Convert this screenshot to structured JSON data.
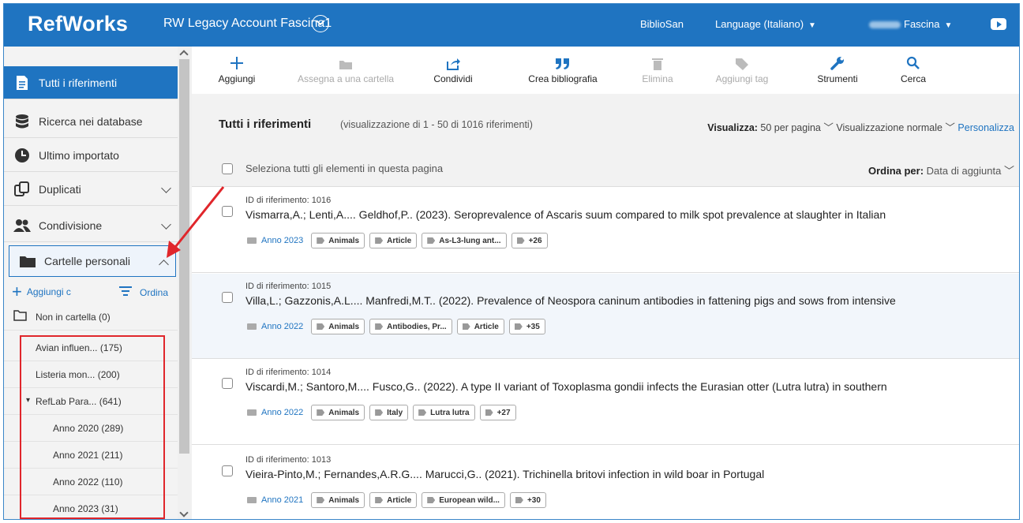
{
  "header": {
    "logo": "RefWorks",
    "account": "RW Legacy Account Fascina1",
    "institution": "BiblioSan",
    "language": "Language (Italiano)",
    "user": "Fascina",
    "caret": "▼"
  },
  "sidebar": {
    "items": [
      {
        "label": "Tutti i riferimenti",
        "icon": "document-icon"
      },
      {
        "label": "Ricerca nei database",
        "icon": "database-icon"
      },
      {
        "label": "Ultimo importato",
        "icon": "clock-icon"
      },
      {
        "label": "Duplicati",
        "icon": "duplicates-icon"
      },
      {
        "label": "Condivisione",
        "icon": "users-icon"
      },
      {
        "label": "Cartelle personali",
        "icon": "folder-icon"
      }
    ],
    "add_folder": "Aggiungi c",
    "order": "Ordina",
    "tree": [
      {
        "label": "Non in cartella (0)"
      },
      {
        "label": "Avian influen... (175)"
      },
      {
        "label": "Listeria mon... (200)"
      },
      {
        "label": "RefLab Para... (641)",
        "toggle": "▾"
      },
      {
        "label": "Anno 2020 (289)"
      },
      {
        "label": "Anno 2021 (211)"
      },
      {
        "label": "Anno 2022 (110)"
      },
      {
        "label": "Anno 2023 (31)"
      }
    ]
  },
  "toolbar": {
    "add": "Aggiungi",
    "assign_folder": "Assegna a una cartella",
    "share": "Condividi",
    "bibliography": "Crea bibliografia",
    "delete": "Elimina",
    "add_tag": "Aggiungi tag",
    "tools": "Strumenti",
    "search": "Cerca"
  },
  "list": {
    "title": "Tutti i riferimenti",
    "subtitle": "(visualizzazione di 1 - 50 di 1016 riferimenti)",
    "view_label": "Visualizza:",
    "per_page": "50 per pagina",
    "view_mode": "Visualizzazione normale",
    "customize": "Personalizza",
    "select_all": "Seleziona tutti gli elementi in questa pagina",
    "sort_label": "Ordina per:",
    "sort_value": "Data di aggiunta"
  },
  "references": [
    {
      "id_label": "ID di riferimento: 1016",
      "title": "Vismarra,A.; Lenti,A.... Geldhof,P.. (2023). Seroprevalence of Ascaris suum compared to milk spot prevalence at slaughter in Italian",
      "folder": "Anno 2023",
      "tags": [
        "Animals",
        "Article",
        "As-L3-lung ant...",
        "+26"
      ]
    },
    {
      "id_label": "ID di riferimento: 1015",
      "title": "Villa,L.; Gazzonis,A.L.... Manfredi,M.T.. (2022). Prevalence of Neospora caninum antibodies in fattening pigs and sows from intensive",
      "folder": "Anno 2022",
      "tags": [
        "Animals",
        "Antibodies, Pr...",
        "Article",
        "+35"
      ]
    },
    {
      "id_label": "ID di riferimento: 1014",
      "title": "Viscardi,M.; Santoro,M.... Fusco,G.. (2022). A type II variant of Toxoplasma gondii infects the Eurasian otter (Lutra lutra) in southern",
      "folder": "Anno 2022",
      "tags": [
        "Animals",
        "Italy",
        "Lutra lutra",
        "+27"
      ]
    },
    {
      "id_label": "ID di riferimento: 1013",
      "title": "Vieira-Pinto,M.; Fernandes,A.R.G.... Marucci,G.. (2021). Trichinella britovi infection in wild boar in Portugal",
      "folder": "Anno 2021",
      "tags": [
        "Animals",
        "Article",
        "European wild...",
        "+30"
      ]
    }
  ],
  "colors": {
    "brand": "#1f74c1",
    "highlight_box": "#e0262b"
  }
}
